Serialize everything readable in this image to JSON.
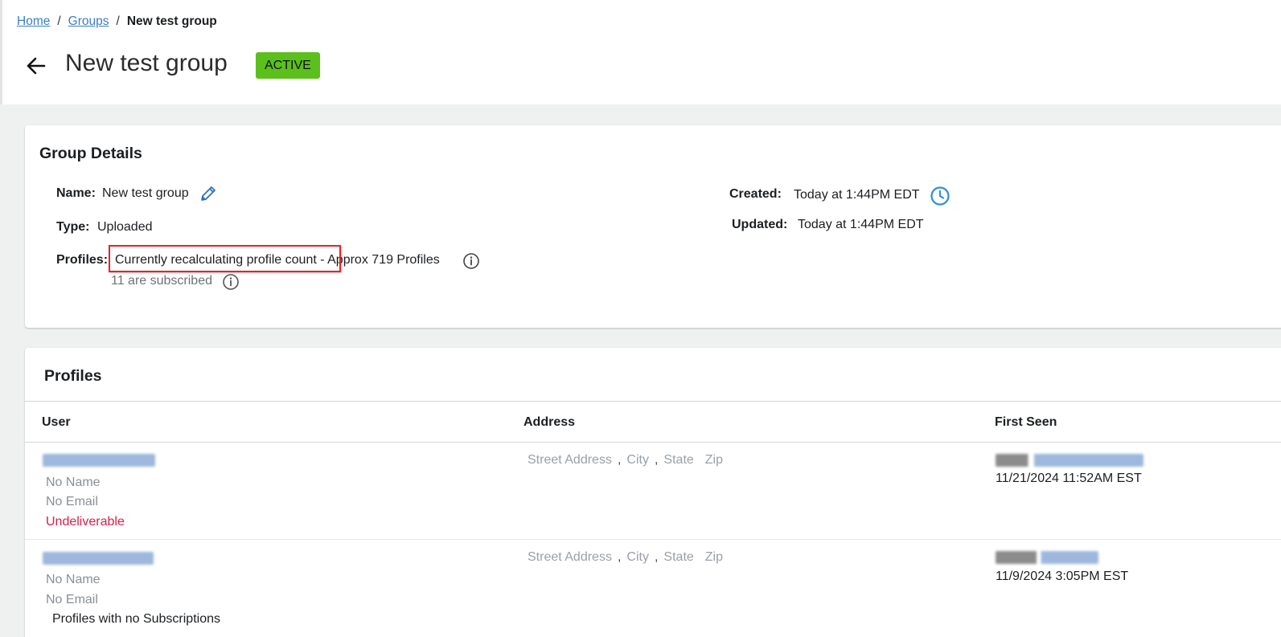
{
  "breadcrumb": {
    "home": "Home",
    "groups": "Groups",
    "separator": "/",
    "current": "New test group"
  },
  "header": {
    "back_icon": "arrow-left-icon",
    "title": "New test group",
    "status": "ACTIVE",
    "status_color": "#5cc01c"
  },
  "details": {
    "title": "Group Details",
    "name_label": "Name:",
    "name_value": "New test group",
    "edit_icon": "pencil-icon",
    "type_label": "Type:",
    "type_value": "Uploaded",
    "profiles_label": "Profiles:",
    "profiles_value": "Currently recalculating profile count - Approx 719 Profiles",
    "subscribed_text": "11 are subscribed",
    "info_icon": "info-icon",
    "created_label": "Created:",
    "created_value": "Today at 1:44PM EDT",
    "clock_icon": "clock-icon",
    "updated_label": "Updated:",
    "updated_value": "Today at 1:44PM EDT"
  },
  "profiles": {
    "title": "Profiles",
    "columns": [
      "User",
      "Address",
      "First Seen"
    ],
    "address_placeholders": {
      "street": "Street Address",
      "city": "City",
      "state": "State",
      "zip": "Zip",
      "comma": ","
    },
    "rows": [
      {
        "name": "No Name",
        "email": "No Email",
        "status": "Undeliverable",
        "status_color": "#d6204d",
        "first_seen": "11/21/2024 11:52AM EST"
      },
      {
        "name": "No Name",
        "email": "No Email",
        "status": "Profiles with no Subscriptions",
        "first_seen": "11/9/2024 3:05PM EST"
      }
    ]
  },
  "colors": {
    "link": "#3b7fc4",
    "highlight": "#e0262b",
    "icon_blue": "#2f8fd8"
  }
}
